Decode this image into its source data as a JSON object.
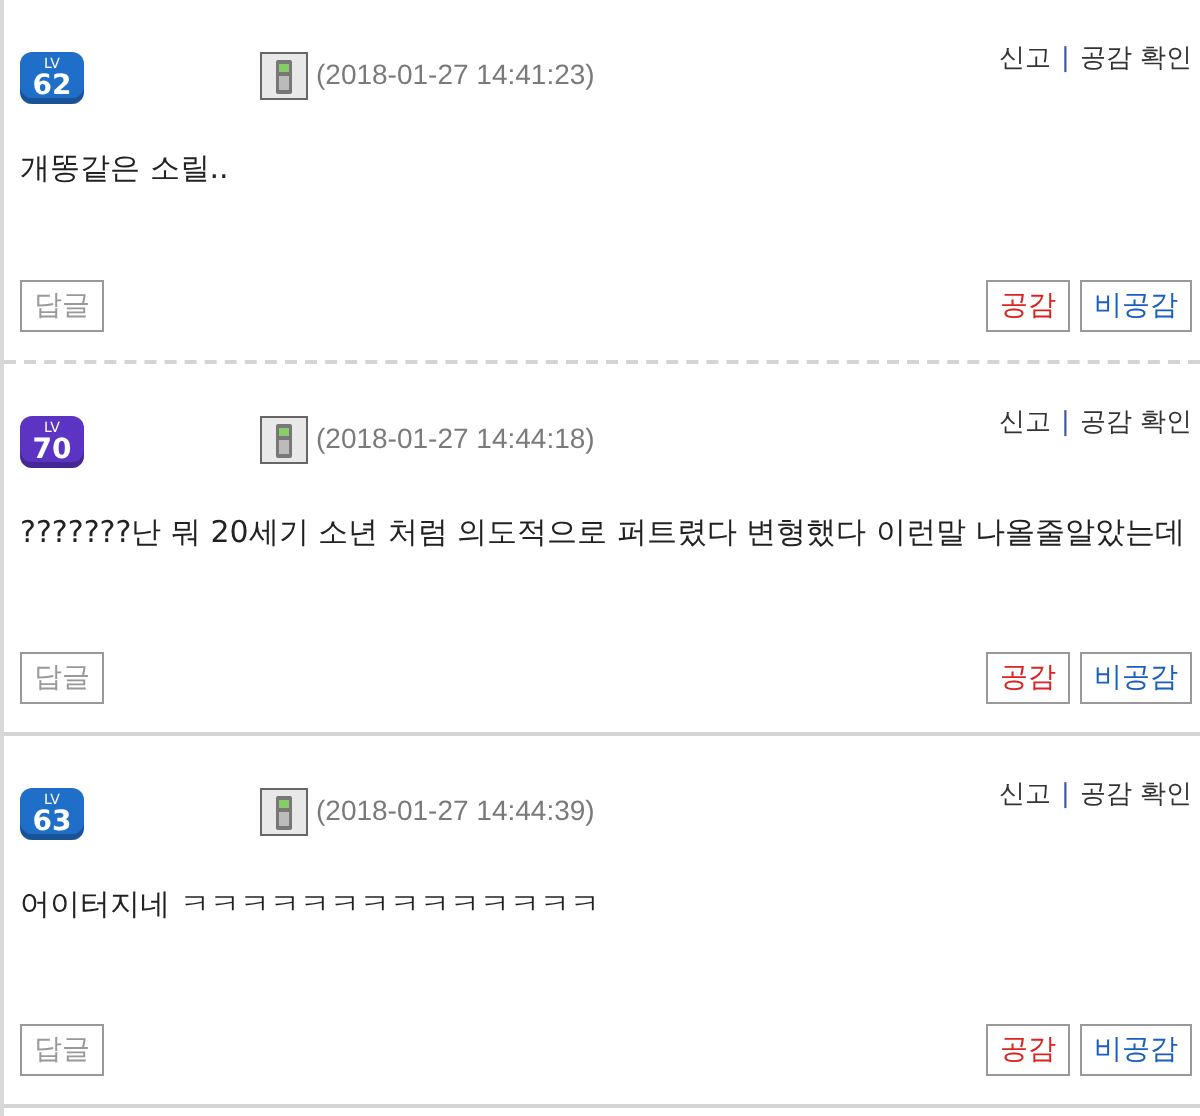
{
  "comments": [
    {
      "kind": "dashed",
      "level_label": "LV",
      "level": "62",
      "color": "#1f6fc8",
      "date": "(2018-01-27 14:41:23)",
      "actions": [
        "신고",
        "|",
        "공감 확인"
      ],
      "body": "개똥같은 소릴..",
      "reply": "답글",
      "like": "공감",
      "dislike": "비공감"
    },
    {
      "kind": "solid",
      "level_label": "LV",
      "level": "70",
      "color": "#5b34c4",
      "date": "(2018-01-27 14:44:18)",
      "actions": [
        "신고",
        "|",
        "공감 확인"
      ],
      "body": "???????난 뭐 20세기 소년 처럼 의도적으로 퍼트렸다 변형했다 이런말 나올줄알았는데",
      "reply": "답글",
      "like": "공감",
      "dislike": "비공감"
    },
    {
      "kind": "solid",
      "level_label": "LV",
      "level": "63",
      "color": "#1f6fc8",
      "date": "(2018-01-27 14:44:39)",
      "actions": [
        "신고",
        "|",
        "공감 확인"
      ],
      "body": "어이터지네 ㅋㅋㅋㅋㅋㅋㅋㅋㅋㅋㅋㅋㅋㅋ",
      "reply": "답글",
      "like": "공감",
      "dislike": "비공감"
    }
  ]
}
